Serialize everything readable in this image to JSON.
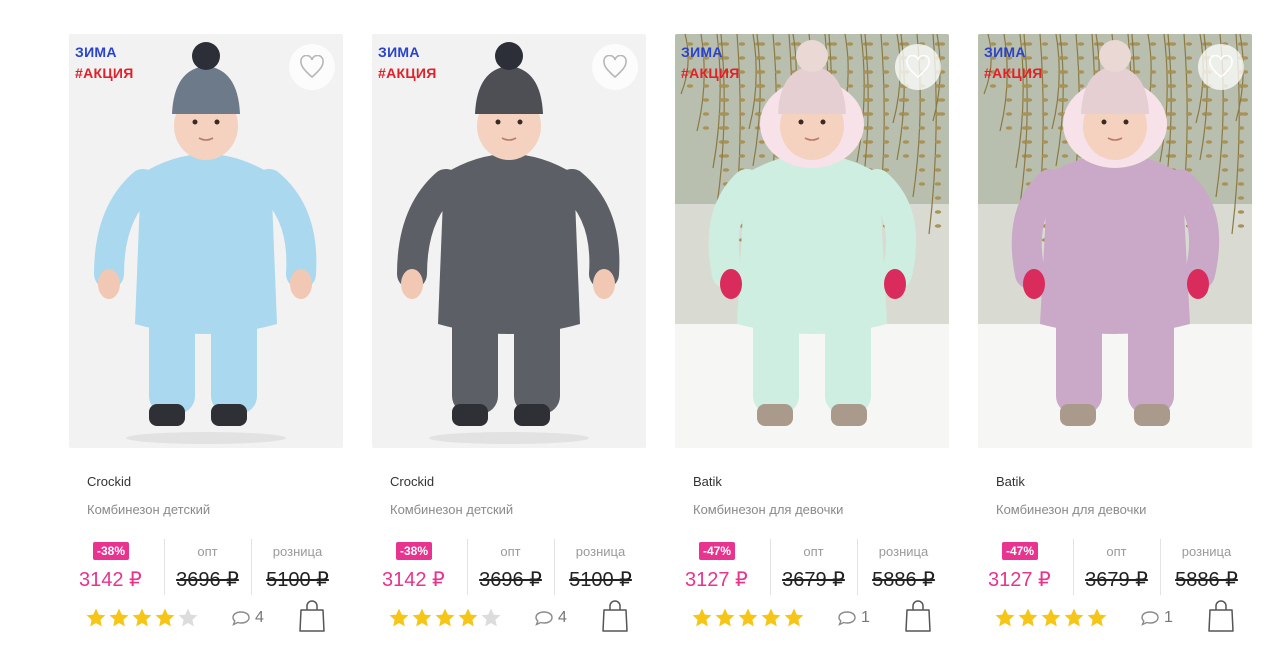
{
  "colors": {
    "season_tag": "#2b43c9",
    "promo_tag": "#e3202a",
    "sale_price": "#e8338f",
    "discount_badge": "#e8338f",
    "star_filled": "#f5c518",
    "star_empty": "#dcdcdc"
  },
  "labels": {
    "wholesale": "опт",
    "retail": "розница"
  },
  "products": [
    {
      "season": "ЗИМА",
      "promo": "#АКЦИЯ",
      "brand": "Crockid",
      "title": "Комбинезон детский",
      "discount": "-38%",
      "sale_price": "3142 ₽",
      "wholesale_price": "3696 ₽",
      "retail_price": "5100 ₽",
      "rating": 4,
      "comments": "4",
      "suit_color": "#a9d8ef",
      "hat_color": "#6d7a8a",
      "background": "outdoor-none"
    },
    {
      "season": "ЗИМА",
      "promo": "#АКЦИЯ",
      "brand": "Crockid",
      "title": "Комбинезон детский",
      "discount": "-38%",
      "sale_price": "3142 ₽",
      "wholesale_price": "3696 ₽",
      "retail_price": "5100 ₽",
      "rating": 4,
      "comments": "4",
      "suit_color": "#5d5f66",
      "hat_color": "#4d4f55",
      "background": "outdoor-none"
    },
    {
      "season": "ЗИМА",
      "promo": "#АКЦИЯ",
      "brand": "Batik",
      "title": "Комбинезон для девочки",
      "discount": "-47%",
      "sale_price": "3127 ₽",
      "wholesale_price": "3679 ₽",
      "retail_price": "5886 ₽",
      "rating": 5,
      "comments": "1",
      "suit_color": "#cdeee0",
      "hat_color": "#e6cfd2",
      "background": "outdoor-snow"
    },
    {
      "season": "ЗИМА",
      "promo": "#АКЦИЯ",
      "brand": "Batik",
      "title": "Комбинезон для девочки",
      "discount": "-47%",
      "sale_price": "3127 ₽",
      "wholesale_price": "3679 ₽",
      "retail_price": "5886 ₽",
      "rating": 5,
      "comments": "1",
      "suit_color": "#c9a8c8",
      "hat_color": "#e6cfd2",
      "background": "outdoor-snow"
    }
  ]
}
